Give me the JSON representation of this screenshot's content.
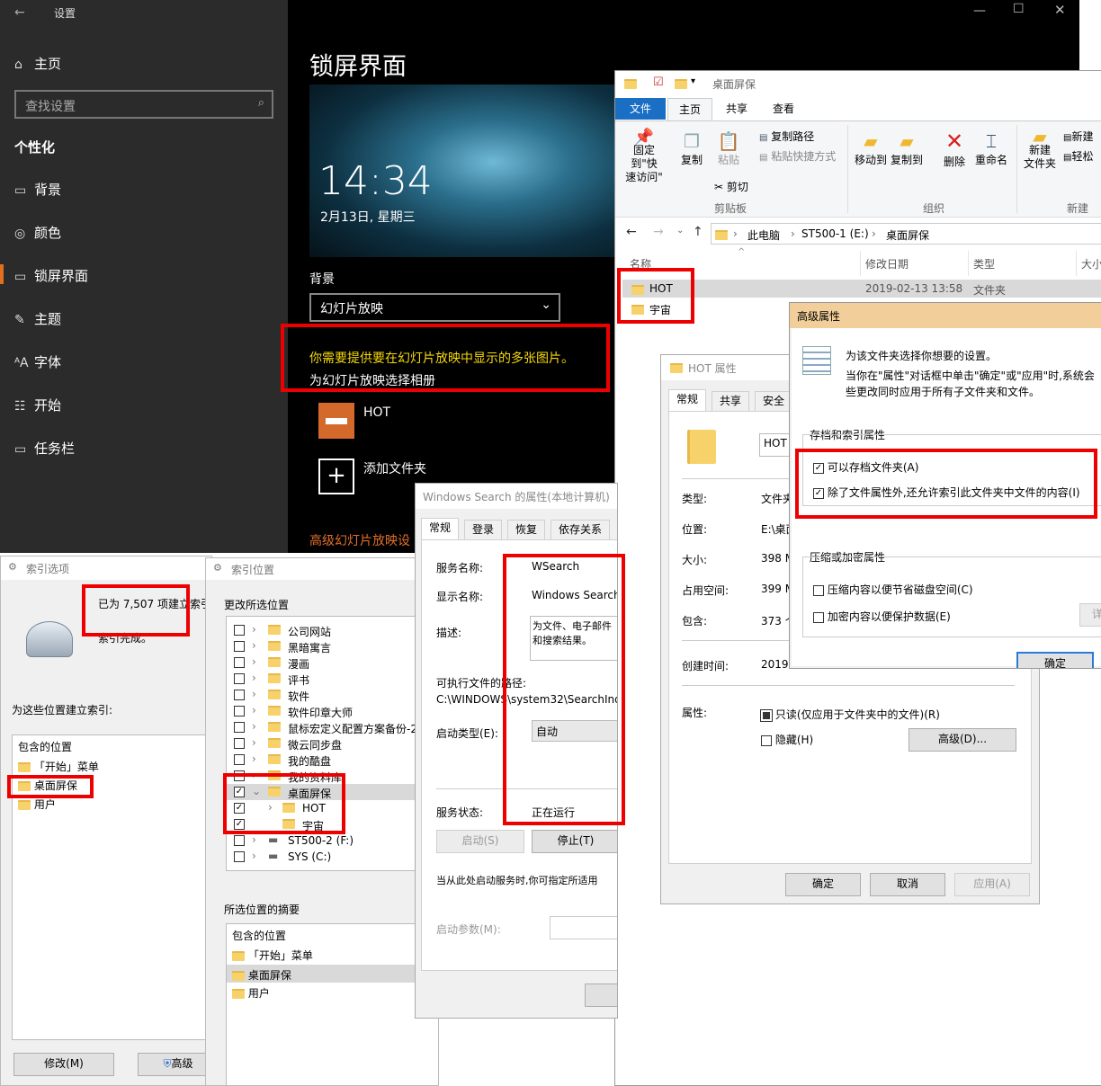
{
  "settings": {
    "title": "设置",
    "nav": {
      "home": "主页",
      "search_placeholder": "查找设置",
      "section": "个性化",
      "items": [
        "背景",
        "颜色",
        "锁屏界面",
        "主题",
        "字体",
        "开始",
        "任务栏"
      ]
    },
    "page_title": "锁屏界面",
    "preview": {
      "time": "14:34",
      "date": "2月13日, 星期三"
    },
    "background_label": "背景",
    "background_value": "幻灯片放映",
    "warning": "你需要提供要在幻灯片放映中显示的多张图片。",
    "album_label": "为幻灯片放映选择相册",
    "albums": [
      "HOT"
    ],
    "add_folder": "添加文件夹",
    "advanced_link": "高级幻灯片放映设"
  },
  "explorer": {
    "title": "桌面屏保",
    "tabs": [
      "文件",
      "主页",
      "共享",
      "查看"
    ],
    "ribbon": {
      "pin": "固定到\"快\n速访问\"",
      "copy": "复制",
      "paste": "粘贴",
      "copy_path": "复制路径",
      "paste_shortcut": "粘贴快捷方式",
      "cut": "剪切",
      "clipboard": "剪贴板",
      "move_to": "移动到",
      "copy_to": "复制到",
      "delete": "删除",
      "rename": "重命名",
      "organize": "组织",
      "new_folder": "新建\n文件夹",
      "new_item": "新建",
      "easy_access": "轻松",
      "new_group": "新建"
    },
    "breadcrumb": [
      "此电脑",
      "ST500-1 (E:)",
      "桌面屏保"
    ],
    "columns": [
      "名称",
      "修改日期",
      "类型",
      "大小"
    ],
    "rows": [
      {
        "name": "HOT",
        "date": "2019-02-13 13:58",
        "type": "文件夹"
      },
      {
        "name": "宇宙",
        "date": "",
        "type": ""
      }
    ]
  },
  "indexing": {
    "title": "索引选项",
    "status_count": "已为 7,507 项建立索引",
    "status_done": "索引完成。",
    "list_label": "为这些位置建立索引:",
    "col_header": "包含的位置",
    "locations": [
      "「开始」菜单",
      "桌面屏保",
      "用户"
    ],
    "modify_btn": "修改(M)",
    "advanced_btn": "高级"
  },
  "indexed_locations": {
    "title": "索引位置",
    "change_label": "更改所选位置",
    "tree": [
      "公司网站",
      "黑暗寓言",
      "漫画",
      "评书",
      "软件",
      "软件印章大师",
      "鼠标宏定义配置方案备份-2",
      "微云同步盘",
      "我的酷盘",
      "我的资料库",
      "桌面屏保",
      "HOT",
      "宇宙",
      "ST500-2 (F:)",
      "SYS (C:)"
    ],
    "summary_label": "所选位置的摘要",
    "summary_header": "包含的位置",
    "summary": [
      "「开始」菜单",
      "桌面屏保",
      "用户"
    ]
  },
  "service": {
    "title": "Windows Search 的属性(本地计算机)",
    "tabs": [
      "常规",
      "登录",
      "恢复",
      "依存关系"
    ],
    "service_name_label": "服务名称:",
    "service_name": "WSearch",
    "display_name_label": "显示名称:",
    "display_name": "Windows Search",
    "desc_label": "描述:",
    "desc": "为文件、电子邮件\n和搜索结果。",
    "path_label": "可执行文件的路径:",
    "path": "C:\\WINDOWS\\system32\\SearchInd",
    "startup_label": "启动类型(E):",
    "startup": "自动",
    "status_label": "服务状态:",
    "status": "正在运行",
    "start_btn": "启动(S)",
    "stop_btn": "停止(T)",
    "hint": "当从此处启动服务时,你可指定所适用",
    "params_label": "启动参数(M):"
  },
  "hot_props": {
    "title": "HOT 属性",
    "tabs": [
      "常规",
      "共享",
      "安全"
    ],
    "name": "HOT",
    "labels": [
      "类型:",
      "位置:",
      "大小:",
      "占用空间:",
      "包含:",
      "创建时间:",
      "属性:"
    ],
    "values": [
      "文件夹",
      "E:\\桌面",
      "398 M",
      "399 M",
      "373 个",
      "2019-"
    ],
    "readonly": "只读(仅应用于文件夹中的文件)(R)",
    "hidden": "隐藏(H)",
    "advanced_btn": "高级(D)...",
    "ok": "确定",
    "cancel": "取消",
    "apply": "应用(A)"
  },
  "adv_props": {
    "title": "高级属性",
    "intro": "为该文件夹选择你想要的设置。",
    "note": "当你在\"属性\"对话框中单击\"确定\"或\"应用\"时,系统会\n些更改同时应用于所有子文件夹和文件。",
    "group1": "存档和索引属性",
    "archive": "可以存档文件夹(A)",
    "index": "除了文件属性外,还允许索引此文件夹中文件的内容(I)",
    "group2": "压缩或加密属性",
    "compress": "压缩内容以便节省磁盘空间(C)",
    "encrypt": "加密内容以便保护数据(E)",
    "details": "详",
    "ok": "确定"
  }
}
